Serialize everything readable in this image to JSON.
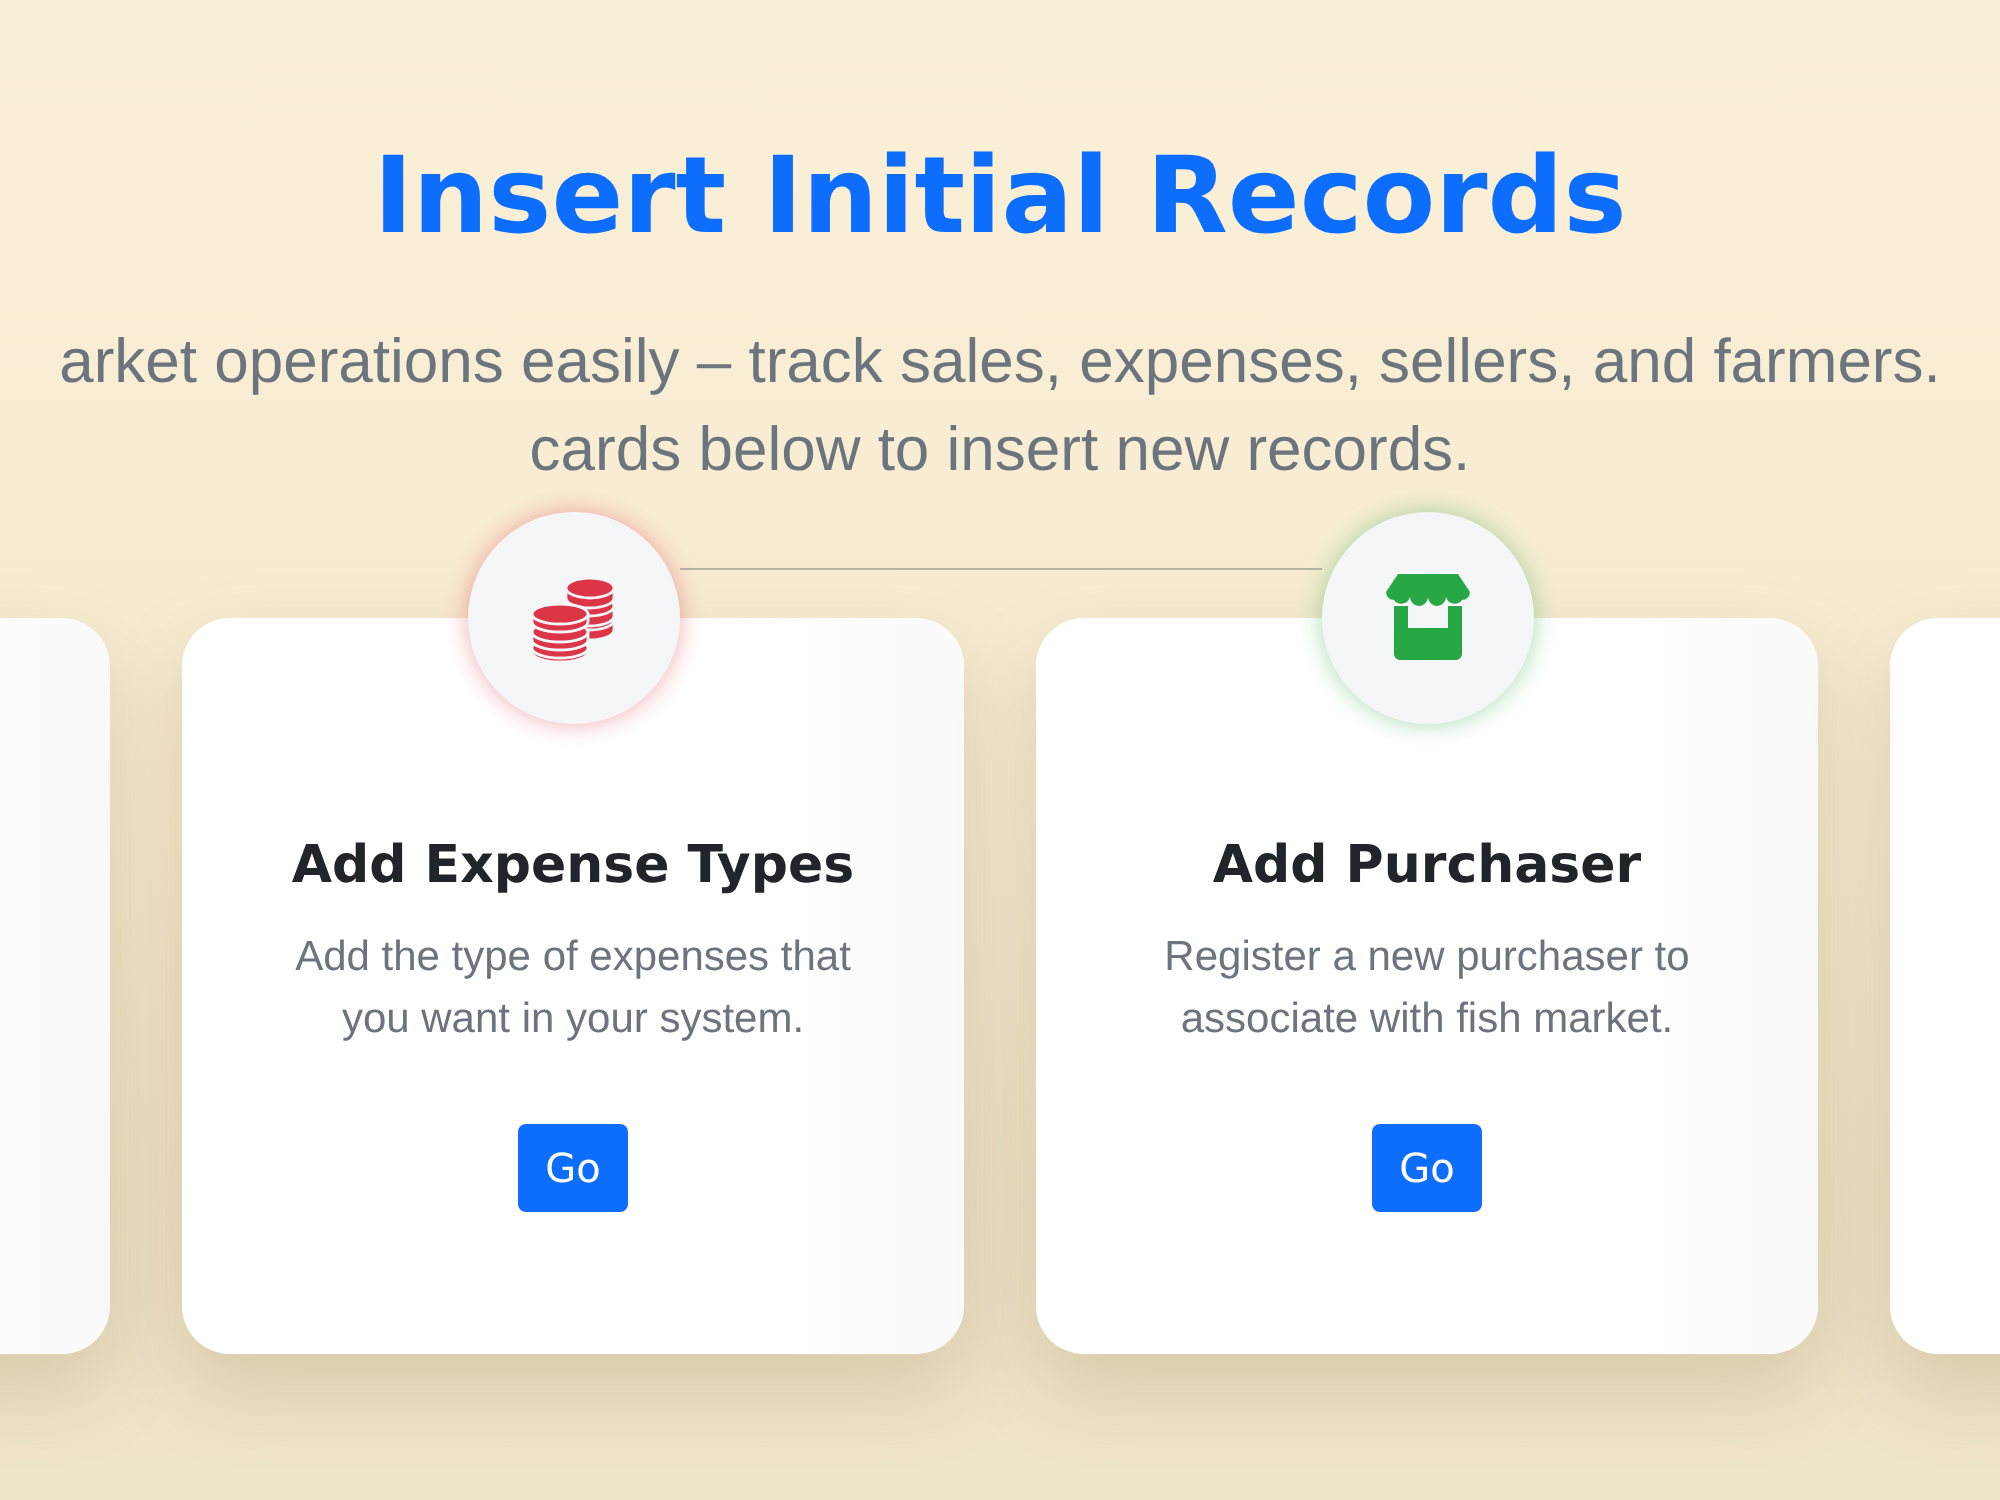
{
  "header": {
    "title": "Insert Initial Records",
    "subtitle_lines": [
      "arket operations easily – track sales, expenses, sellers, and farmers.",
      "cards below to insert new records."
    ]
  },
  "cards": [
    {
      "kind": "edge"
    },
    {
      "kind": "full",
      "color": "#dc3545",
      "title": "Add Expense Types",
      "description": "Add the type of expenses that you want in your system.",
      "button": "Go"
    },
    {
      "kind": "full",
      "color": "#28a745",
      "title": "Add Purchaser",
      "description": "Register a new purchaser to associate with fish market.",
      "button": "Go"
    },
    {
      "kind": "edge"
    }
  ]
}
